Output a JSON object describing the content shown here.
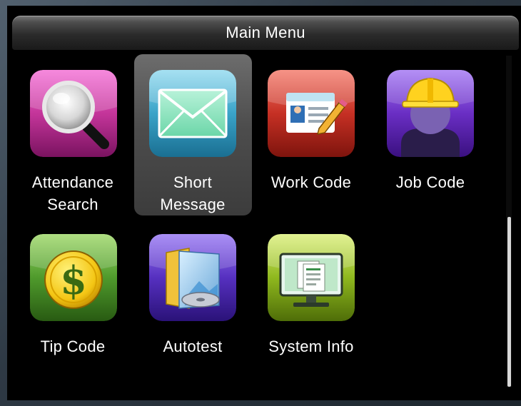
{
  "title": "Main Menu",
  "selected_index": 1,
  "items": [
    {
      "label_line1": "Attendance",
      "label_line2": "Search",
      "icon": "magnifier-icon",
      "color": "#c4359a"
    },
    {
      "label_line1": "Short",
      "label_line2": "Message",
      "icon": "envelope-icon",
      "color": "#3aa3c8"
    },
    {
      "label_line1": "Work Code",
      "label_line2": "",
      "icon": "id-card-pencil-icon",
      "color": "#c63024"
    },
    {
      "label_line1": "Job Code",
      "label_line2": "",
      "icon": "worker-hardhat-icon",
      "color": "#6a2ec4"
    },
    {
      "label_line1": "Tip Code",
      "label_line2": "",
      "icon": "dollar-coin-icon",
      "color": "#4f9a2c"
    },
    {
      "label_line1": "Autotest",
      "label_line2": "",
      "icon": "folder-disc-icon",
      "color": "#5630c0"
    },
    {
      "label_line1": "System Info",
      "label_line2": "",
      "icon": "monitor-document-icon",
      "color": "#8fb81e"
    }
  ]
}
